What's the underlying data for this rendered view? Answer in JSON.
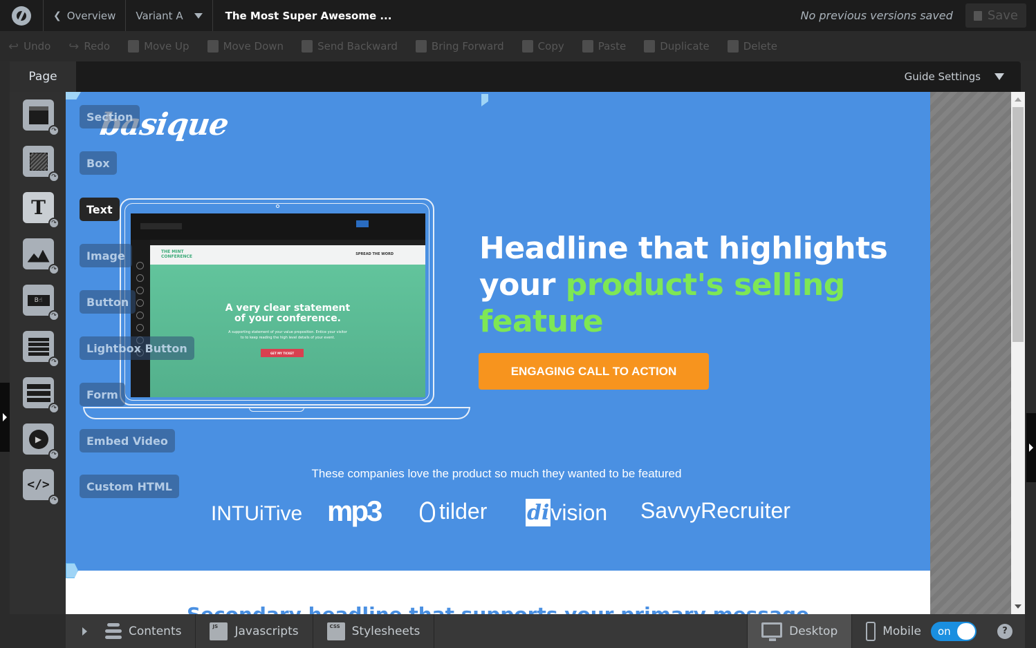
{
  "topbar": {
    "logo": "unbounce-logo-icon",
    "overview_label": "Overview",
    "variant_label": "Variant A",
    "page_title": "The Most Super Awesome ...",
    "versions_status": "No previous versions saved",
    "save_label": "Save"
  },
  "toolbar": {
    "items": [
      {
        "label": "Undo",
        "icon": "undo-icon"
      },
      {
        "label": "Redo",
        "icon": "redo-icon"
      },
      {
        "label": "Move Up",
        "icon": "move-up-icon"
      },
      {
        "label": "Move Down",
        "icon": "move-down-icon"
      },
      {
        "label": "Send Backward",
        "icon": "send-backward-icon"
      },
      {
        "label": "Bring Forward",
        "icon": "bring-forward-icon"
      },
      {
        "label": "Copy",
        "icon": "copy-icon"
      },
      {
        "label": "Paste",
        "icon": "paste-icon"
      },
      {
        "label": "Duplicate",
        "icon": "duplicate-icon"
      },
      {
        "label": "Delete",
        "icon": "trash-icon"
      }
    ]
  },
  "pagebar": {
    "page_tab": "Page",
    "guide_settings": "Guide Settings"
  },
  "widgets": [
    {
      "label": "Section",
      "icon": "section-icon"
    },
    {
      "label": "Box",
      "icon": "box-icon"
    },
    {
      "label": "Text",
      "icon": "text-icon",
      "active": true
    },
    {
      "label": "Image",
      "icon": "image-icon"
    },
    {
      "label": "Button",
      "icon": "button-icon"
    },
    {
      "label": "Lightbox Button",
      "icon": "lightbox-icon"
    },
    {
      "label": "Form",
      "icon": "form-icon"
    },
    {
      "label": "Embed Video",
      "icon": "video-play-icon"
    },
    {
      "label": "Custom HTML",
      "icon": "code-icon"
    }
  ],
  "canvas": {
    "brand": "basique",
    "headline_white_1": "Headline that highlights",
    "headline_white_2": "your ",
    "headline_green_2": "product's selling",
    "headline_green_3": "feature",
    "cta_label": "ENGAGING CALL TO ACTION",
    "featured_text": "These companies love the product so much they wanted to be featured",
    "logos": [
      "INTUiTive",
      "mp3",
      "tilder",
      "division",
      "SavvyRecruiter"
    ],
    "secondary_headline": "Secondary headline that supports your primary message",
    "colors": {
      "hero_bg": "#4a90e2",
      "accent_green": "#7ee755",
      "cta_orange": "#f7941e"
    },
    "laptop_screen": {
      "logo": "THE MINT CONFERENCE",
      "spread": "SPREAD THE WORD",
      "headline_1": "A very clear statement",
      "headline_2": "of your conference.",
      "sub": "A supporting statement of your value proposition. Entice your visitor to to keep reading the high level details of your event.",
      "button": "GET MY TICKET"
    }
  },
  "bottombar": {
    "contents_label": "Contents",
    "javascripts_label": "Javascripts",
    "js_badge": "JS",
    "stylesheets_label": "Stylesheets",
    "css_badge": "CSS",
    "desktop_label": "Desktop",
    "mobile_label": "Mobile",
    "mobile_toggle": "on",
    "help_label": "?"
  }
}
